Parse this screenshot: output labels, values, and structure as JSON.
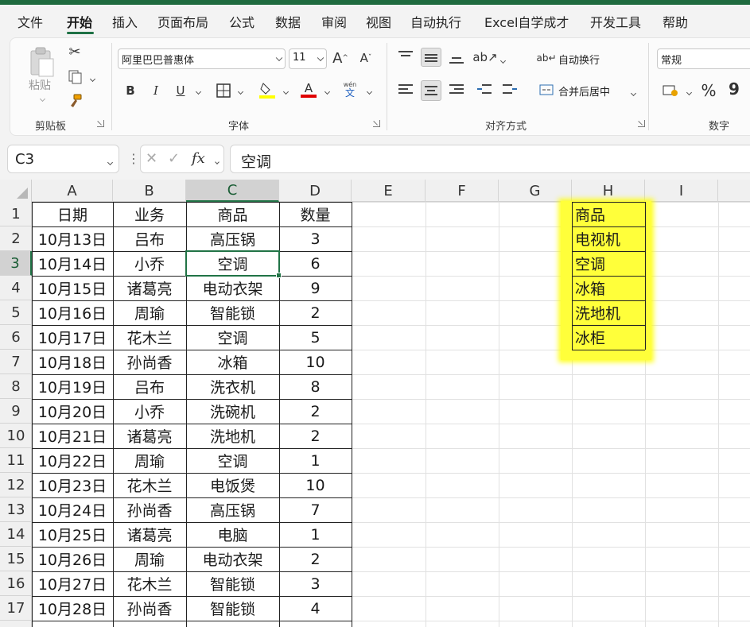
{
  "menu": {
    "tabs": [
      "文件",
      "开始",
      "插入",
      "页面布局",
      "公式",
      "数据",
      "审阅",
      "视图",
      "自动执行",
      "Excel自学成才",
      "开发工具",
      "帮助"
    ],
    "active": "开始"
  },
  "ribbon": {
    "clipboard": {
      "group_label": "剪贴板",
      "paste_label": "粘贴"
    },
    "font": {
      "group_label": "字体",
      "font_name": "阿里巴巴普惠体",
      "font_size": "11",
      "bold": "B",
      "italic": "I",
      "underline": "U",
      "grow": "A",
      "shrink": "A",
      "phonetic_top": "wén",
      "phonetic_bottom": "文",
      "font_color_letter": "A"
    },
    "alignment": {
      "group_label": "对齐方式",
      "wrap_text": "自动换行",
      "merge_center": "合并后居中"
    },
    "number": {
      "group_label": "数字",
      "format": "常规",
      "percent": "%",
      "comma": "9"
    }
  },
  "formula_bar": {
    "name_box": "C3",
    "fx_label": "fx",
    "cancel": "✕",
    "enter": "✓",
    "content": "空调"
  },
  "columns": [
    "A",
    "B",
    "C",
    "D",
    "E",
    "F",
    "G",
    "H",
    "I"
  ],
  "selected_column": "C",
  "rows": [
    "1",
    "2",
    "3",
    "4",
    "5",
    "6",
    "7",
    "8",
    "9",
    "10",
    "11",
    "12",
    "13",
    "14",
    "15",
    "16",
    "17"
  ],
  "selected_row": "3",
  "table": [
    [
      "日期",
      "业务",
      "商品",
      "数量"
    ],
    [
      "10月13日",
      "吕布",
      "高压锅",
      "3"
    ],
    [
      "10月14日",
      "小乔",
      "空调",
      "6"
    ],
    [
      "10月15日",
      "诸葛亮",
      "电动衣架",
      "9"
    ],
    [
      "10月16日",
      "周瑜",
      "智能锁",
      "2"
    ],
    [
      "10月17日",
      "花木兰",
      "空调",
      "5"
    ],
    [
      "10月18日",
      "孙尚香",
      "冰箱",
      "10"
    ],
    [
      "10月19日",
      "吕布",
      "洗衣机",
      "8"
    ],
    [
      "10月20日",
      "小乔",
      "洗碗机",
      "2"
    ],
    [
      "10月21日",
      "诸葛亮",
      "洗地机",
      "2"
    ],
    [
      "10月22日",
      "周瑜",
      "空调",
      "1"
    ],
    [
      "10月23日",
      "花木兰",
      "电饭煲",
      "10"
    ],
    [
      "10月24日",
      "孙尚香",
      "高压锅",
      "7"
    ],
    [
      "10月25日",
      "诸葛亮",
      "电脑",
      "1"
    ],
    [
      "10月26日",
      "周瑜",
      "电动衣架",
      "2"
    ],
    [
      "10月27日",
      "花木兰",
      "智能锁",
      "3"
    ],
    [
      "10月28日",
      "孙尚香",
      "智能锁",
      "4"
    ]
  ],
  "lookup_list": [
    "商品",
    "电视机",
    "空调",
    "冰箱",
    "洗地机",
    "冰柜"
  ],
  "colors": {
    "accent": "#217346",
    "highlight": "#ffff3a",
    "title_strip": "#1f6b3f"
  }
}
